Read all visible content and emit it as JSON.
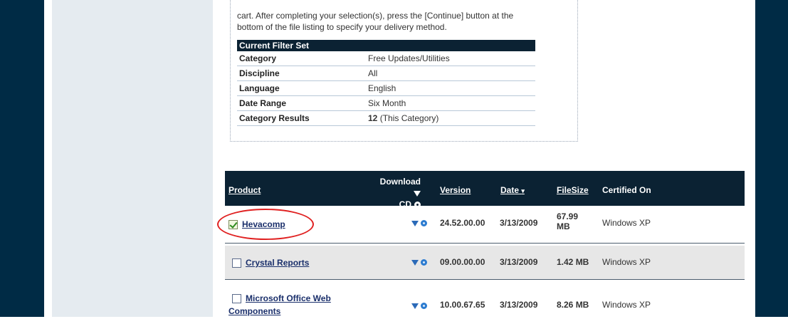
{
  "intro": {
    "line1": "cart. After completing your selection(s), press the [Continue] button at the",
    "line2": "bottom of the file listing to specify your delivery method."
  },
  "filter": {
    "title": "Current Filter Set",
    "rows": [
      {
        "label": "Category",
        "value": "Free Updates/Utilities"
      },
      {
        "label": "Discipline",
        "value": "All"
      },
      {
        "label": "Language",
        "value": "English"
      },
      {
        "label": "Date Range",
        "value": "Six Month"
      },
      {
        "label": "Category Results",
        "value_bold": "12",
        "value_rest": "(This Category)"
      }
    ]
  },
  "table": {
    "headers": {
      "product": "Product",
      "download": "Download",
      "cd": "CD",
      "version": "Version",
      "date": "Date",
      "date_arrow": "▾",
      "filesize": "FileSize",
      "certified": "Certified On"
    },
    "rows": [
      {
        "checked": true,
        "product": "Hevacomp",
        "version": "24.52.00.00",
        "date": "3/13/2009",
        "size_l1": "67.99",
        "size_l2": "MB",
        "certified": "Windows XP",
        "bg": "#ffffff"
      },
      {
        "checked": false,
        "product": "Crystal Reports",
        "version": "09.00.00.00",
        "date": "3/13/2009",
        "size_l1": "1.42 MB",
        "size_l2": "",
        "certified": "Windows XP",
        "bg": "#e7e7e7"
      },
      {
        "checked": false,
        "product_l1": "Microsoft Office Web",
        "product_l2": "Components",
        "version": "10.00.67.65",
        "date": "3/13/2009",
        "size_l1": "8.26 MB",
        "size_l2": "",
        "certified": "Windows XP",
        "bg": "#ffffff"
      }
    ]
  },
  "colors": {
    "sidebar": "#002b45",
    "header": "#0b2233",
    "highlight_circle": "#e02020",
    "link": "#1a2f6b"
  }
}
